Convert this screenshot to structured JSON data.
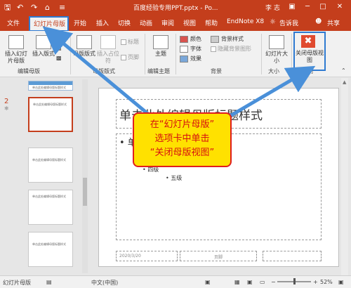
{
  "titlebar": {
    "save_icon": "save-icon",
    "undo_glyph": "↶",
    "redo_glyph": "↷",
    "start_glyph": "⌂",
    "customize_glyph": "≡",
    "document_title": "百度经验专用PPT.pptx - Po...",
    "user": "李 志",
    "restore_glyph": "▣",
    "minimize_glyph": "─",
    "maximize_glyph": "□",
    "close_glyph": "✕"
  },
  "tabs": [
    {
      "label": "文件"
    },
    {
      "label": "幻灯片母版"
    },
    {
      "label": "开始"
    },
    {
      "label": "插入"
    },
    {
      "label": "切换"
    },
    {
      "label": "动画"
    },
    {
      "label": "审阅"
    },
    {
      "label": "视图"
    },
    {
      "label": "帮助"
    },
    {
      "label": "EndNote X8"
    },
    {
      "label": "告诉我"
    },
    {
      "label": "共享"
    }
  ],
  "ribbon": {
    "insert_master": "插入幻灯片母版",
    "insert_layout": "插入版式",
    "master_layout": "母版版式",
    "insert_placeholder": "插入占位符",
    "title": "标题",
    "footer": "页脚",
    "theme": "主题",
    "colors": "颜色",
    "fonts": "字体",
    "effects": "效果",
    "background_styles": "背景样式",
    "hide_background": "隐藏背景图形",
    "slide_size": "幻灯片大小",
    "close_master": "关闭母版视图",
    "group_edit_master": "编辑母版",
    "group_master_layout": "母版版式",
    "group_edit_theme": "编辑主题",
    "group_background": "背景",
    "group_size": "大小",
    "group_close": "关闭"
  },
  "thumbnails": {
    "selected_number": "2",
    "master_caption": "单击此处编辑母版标题样式",
    "items": [
      {
        "caption": "单击此处编辑母版标题样式"
      },
      {
        "caption": "单击此处编辑母版标题样式"
      },
      {
        "caption": "单击此处编辑母版标题样式"
      },
      {
        "caption": "单击此处编辑母版标题样式"
      }
    ]
  },
  "slide": {
    "title_placeholder": "单击此处编辑母版标题样式",
    "bullet1": "• 单",
    "bullet4": "• 四级",
    "bullet5": "• 五级",
    "date": "2020/3/20",
    "footer": "页脚"
  },
  "callout": {
    "line1": "在“幻灯片母版”",
    "line2": "选项卡中单击",
    "line3": "“关闭母版视图”"
  },
  "statusbar": {
    "view": "幻灯片母版",
    "language": "中文(中国)",
    "zoom": "52%",
    "zoom_fraction": 0.52
  },
  "colors": {
    "accent": "#c43e1c",
    "highlight_box": "#2e7ad1",
    "callout_bg": "#ffe100",
    "callout_border": "#e01e1e"
  }
}
